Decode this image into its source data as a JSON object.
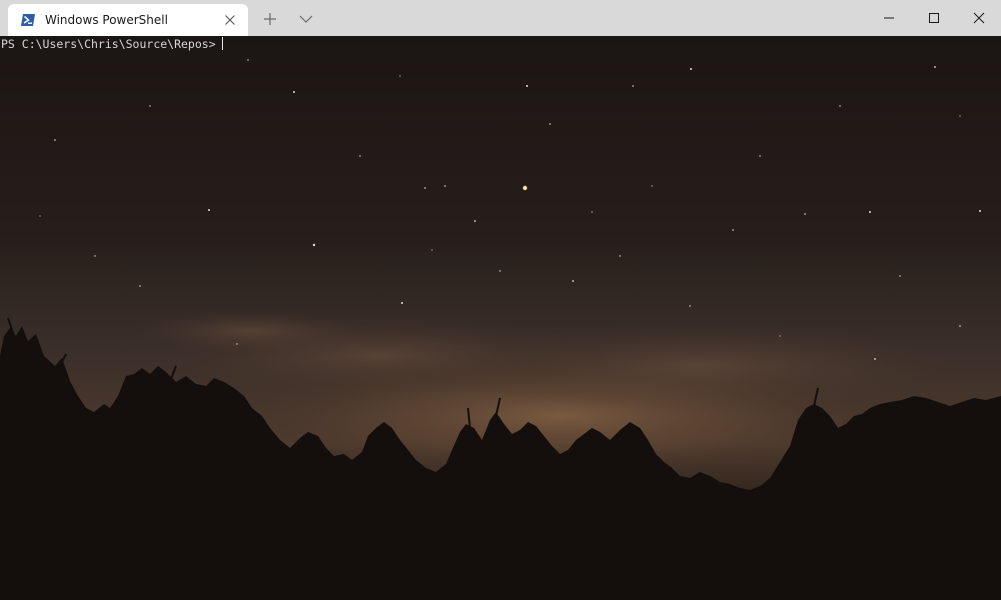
{
  "window": {
    "tab_title": "Windows PowerShell",
    "icons": {
      "tab_icon": "powershell-icon",
      "tab_close": "close-icon",
      "new_tab": "plus-icon",
      "dropdown": "chevron-down-icon",
      "minimize": "minimize-icon",
      "maximize": "maximize-icon",
      "close": "close-icon"
    }
  },
  "terminal": {
    "prompt": "PS C:\\Users\\Chris\\Source\\Repos>",
    "input": ""
  },
  "colors": {
    "tabbar_bg": "#d9d9d9",
    "tab_bg": "#ffffff",
    "powershell_blue": "#2b5ea7",
    "terminal_text": "#d8d8d8"
  }
}
